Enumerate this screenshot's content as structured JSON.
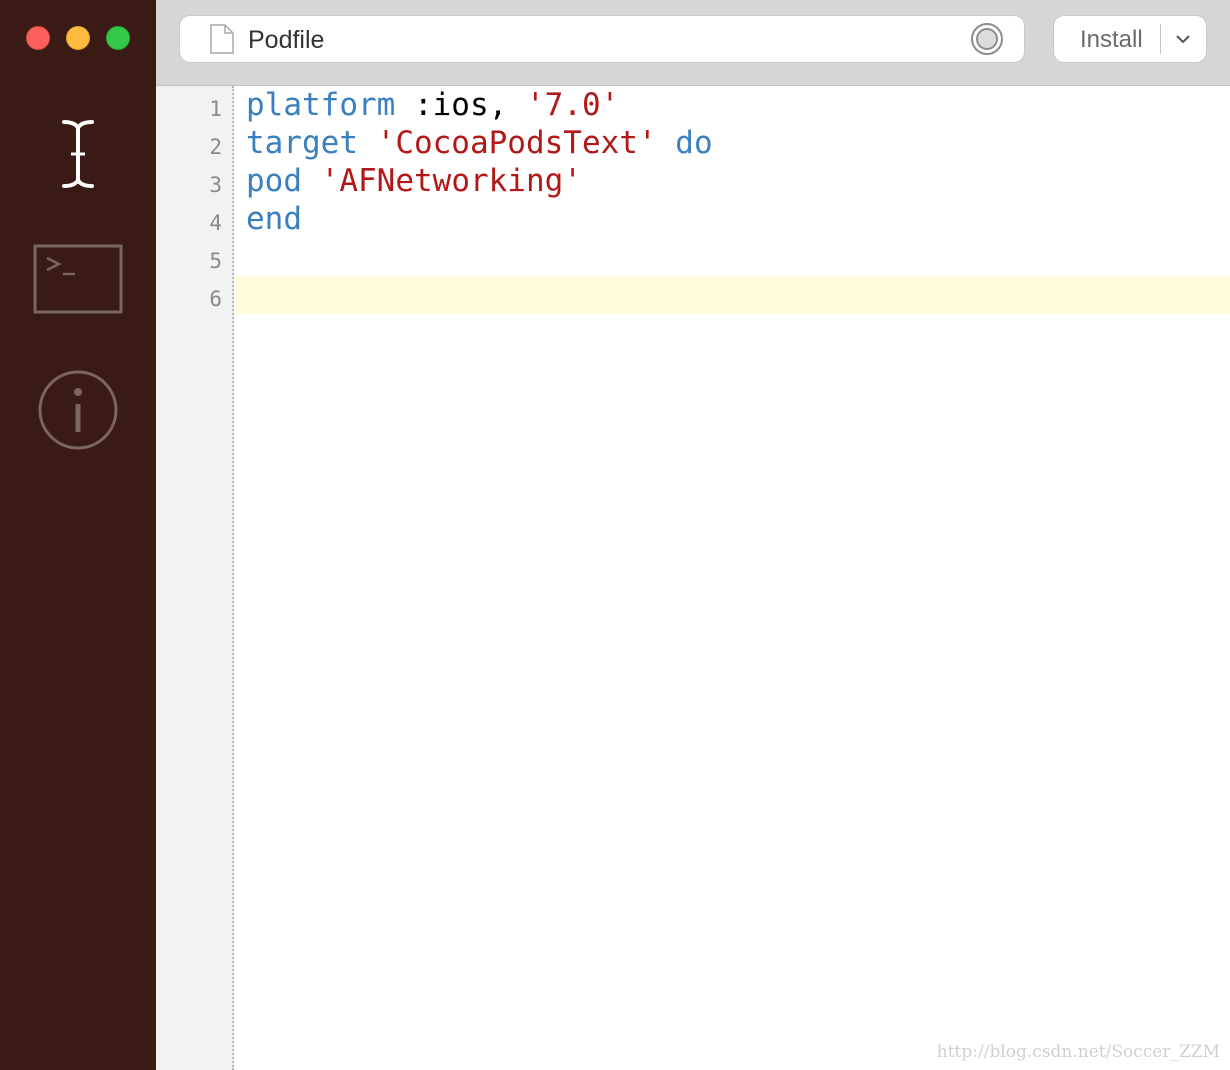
{
  "window": {
    "traffic_lights": {
      "close_color": "#fc605c",
      "minimize_color": "#fdbc40",
      "zoom_color": "#34c84a"
    }
  },
  "sidebar": {
    "background": "#3a1a14",
    "items": [
      {
        "icon": "text-cursor-icon",
        "active": true
      },
      {
        "icon": "terminal-icon",
        "active": false
      },
      {
        "icon": "info-icon",
        "active": false
      }
    ]
  },
  "toolbar": {
    "file_icon": "document-icon",
    "file_name": "Podfile",
    "record_icon": "record-icon",
    "install_label": "Install",
    "install_menu_icon": "chevron-down-icon"
  },
  "editor": {
    "line_numbers": [
      "1",
      "2",
      "3",
      "4",
      "5",
      "6"
    ],
    "current_line": 6,
    "lines": [
      {
        "t0": "platform",
        "t1": " :ios, ",
        "t2": "'7.0'"
      },
      {
        "t0": "target",
        "t1": " ",
        "t2": "'CocoaPodsText'",
        "t3": " ",
        "t4": "do"
      },
      {
        "t0": "pod",
        "t1": " ",
        "t2": "'AFNetworking'"
      },
      {
        "t0": "end"
      },
      {},
      {}
    ],
    "colors": {
      "keyword": "#3a7fbf",
      "string": "#b21818",
      "current_line": "#fffbdd"
    }
  },
  "watermark": "http://blog.csdn.net/Soccer_ZZM"
}
